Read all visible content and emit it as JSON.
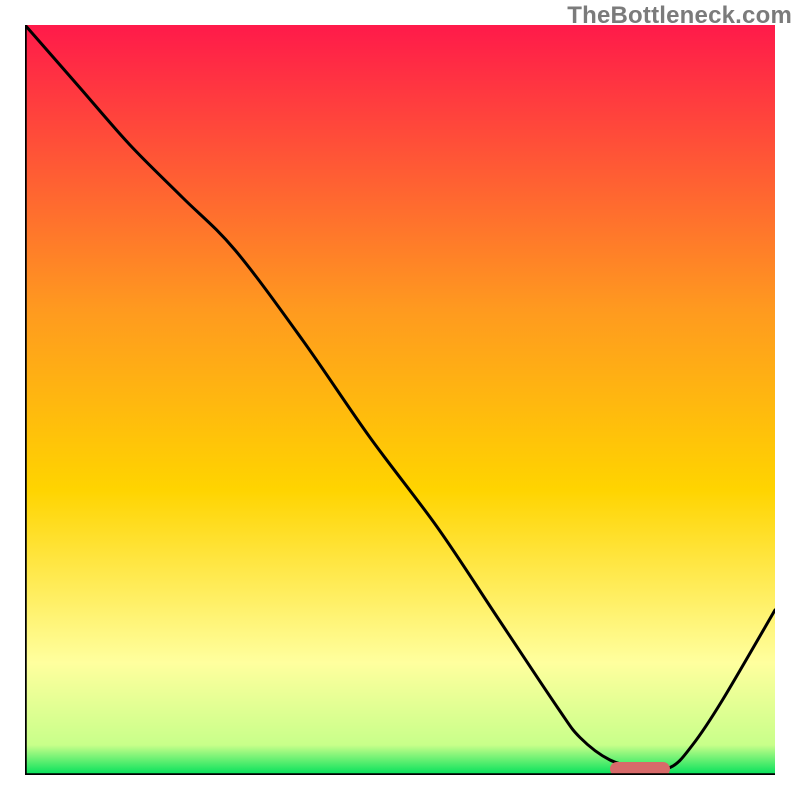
{
  "watermark": "TheBottleneck.com",
  "colors": {
    "gradient_top": "#ff1a4a",
    "gradient_mid1": "#ff7a1f",
    "gradient_mid2": "#ffd400",
    "gradient_pale": "#ffff9e",
    "gradient_bottom": "#00e05a",
    "line": "#000000",
    "marker": "#d86a6a",
    "frame": "#000000"
  },
  "chart_data": {
    "type": "line",
    "title": "",
    "xlabel": "",
    "ylabel": "",
    "xlim": [
      0,
      100
    ],
    "ylim": [
      0,
      100
    ],
    "grid": false,
    "series": [
      {
        "name": "curve",
        "x": [
          0,
          7,
          14,
          21,
          28,
          37,
          46,
          55,
          63,
          71,
          74,
          78,
          82,
          86,
          89,
          93,
          100
        ],
        "y": [
          100,
          92,
          84,
          77,
          70,
          58,
          45,
          33,
          21,
          9,
          5,
          2,
          1,
          1,
          4,
          10,
          22
        ]
      }
    ],
    "marker": {
      "x_start": 78,
      "x_end": 86,
      "y": 0.8
    }
  }
}
